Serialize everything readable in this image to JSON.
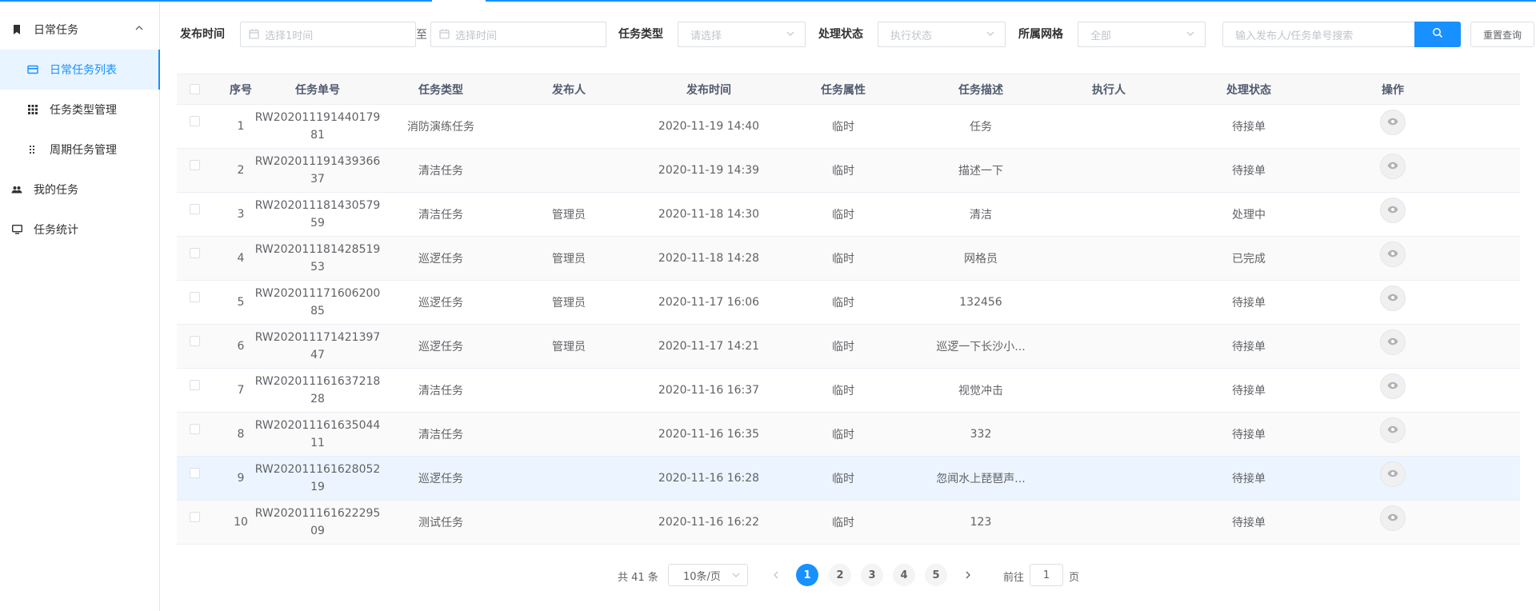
{
  "sidebar": {
    "group1": "日常任务",
    "items": [
      "日常任务列表",
      "任务类型管理",
      "周期任务管理"
    ],
    "group2": "我的任务",
    "group3": "任务统计"
  },
  "filters": {
    "publish_time_label": "发布时间",
    "start_placeholder": "选择1时间",
    "to": "至",
    "end_placeholder": "选择时间",
    "task_type_label": "任务类型",
    "task_type_placeholder": "请选择",
    "status_label": "处理状态",
    "status_placeholder": "执行状态",
    "grid_label": "所属网格",
    "grid_value": "全部",
    "search_placeholder": "输入发布人/任务单号搜索",
    "reset_label": "重置查询"
  },
  "table": {
    "headers": [
      "序号",
      "任务单号",
      "任务类型",
      "发布人",
      "发布时间",
      "任务属性",
      "任务描述",
      "执行人",
      "处理状态",
      "操作"
    ],
    "rows": [
      {
        "no": "1",
        "code1": "RW202011191440179",
        "code2": "81",
        "type": "消防演练任务",
        "publisher": "",
        "time": "2020-11-19 14:40",
        "attr": "临时",
        "desc": "任务",
        "executor": "",
        "status": "待接单"
      },
      {
        "no": "2",
        "code1": "RW202011191439366",
        "code2": "37",
        "type": "清洁任务",
        "publisher": "",
        "time": "2020-11-19 14:39",
        "attr": "临时",
        "desc": "描述一下",
        "executor": "",
        "status": "待接单"
      },
      {
        "no": "3",
        "code1": "RW202011181430579",
        "code2": "59",
        "type": "清洁任务",
        "publisher": "管理员",
        "time": "2020-11-18 14:30",
        "attr": "临时",
        "desc": "清洁",
        "executor": "",
        "status": "处理中"
      },
      {
        "no": "4",
        "code1": "RW202011181428519",
        "code2": "53",
        "type": "巡逻任务",
        "publisher": "管理员",
        "time": "2020-11-18 14:28",
        "attr": "临时",
        "desc": "网格员",
        "executor": "",
        "status": "已完成"
      },
      {
        "no": "5",
        "code1": "RW202011171606200",
        "code2": "85",
        "type": "巡逻任务",
        "publisher": "管理员",
        "time": "2020-11-17 16:06",
        "attr": "临时",
        "desc": "132456",
        "executor": "",
        "status": "待接单"
      },
      {
        "no": "6",
        "code1": "RW202011171421397",
        "code2": "47",
        "type": "巡逻任务",
        "publisher": "管理员",
        "time": "2020-11-17 14:21",
        "attr": "临时",
        "desc": "巡逻一下长沙小...",
        "executor": "",
        "status": "待接单"
      },
      {
        "no": "7",
        "code1": "RW202011161637218",
        "code2": "28",
        "type": "清洁任务",
        "publisher": "",
        "time": "2020-11-16 16:37",
        "attr": "临时",
        "desc": "视觉冲击",
        "executor": "",
        "status": "待接单"
      },
      {
        "no": "8",
        "code1": "RW202011161635044",
        "code2": "11",
        "type": "清洁任务",
        "publisher": "",
        "time": "2020-11-16 16:35",
        "attr": "临时",
        "desc": "332",
        "executor": "",
        "status": "待接单"
      },
      {
        "no": "9",
        "code1": "RW202011161628052",
        "code2": "19",
        "type": "巡逻任务",
        "publisher": "",
        "time": "2020-11-16 16:28",
        "attr": "临时",
        "desc": "忽闻水上琵琶声...",
        "executor": "",
        "status": "待接单"
      },
      {
        "no": "10",
        "code1": "RW202011161622295",
        "code2": "09",
        "type": "测试任务",
        "publisher": "",
        "time": "2020-11-16 16:22",
        "attr": "临时",
        "desc": "123",
        "executor": "",
        "status": "待接单"
      }
    ]
  },
  "pagination": {
    "total": "共 41 条",
    "page_size": "10条/页",
    "pages": [
      "1",
      "2",
      "3",
      "4",
      "5"
    ],
    "current": "1",
    "goto_label": "前往",
    "goto_value": "1",
    "page_label": "页"
  },
  "colors": {
    "accent": "#1890ff",
    "hover_row": "#ecf5ff"
  }
}
